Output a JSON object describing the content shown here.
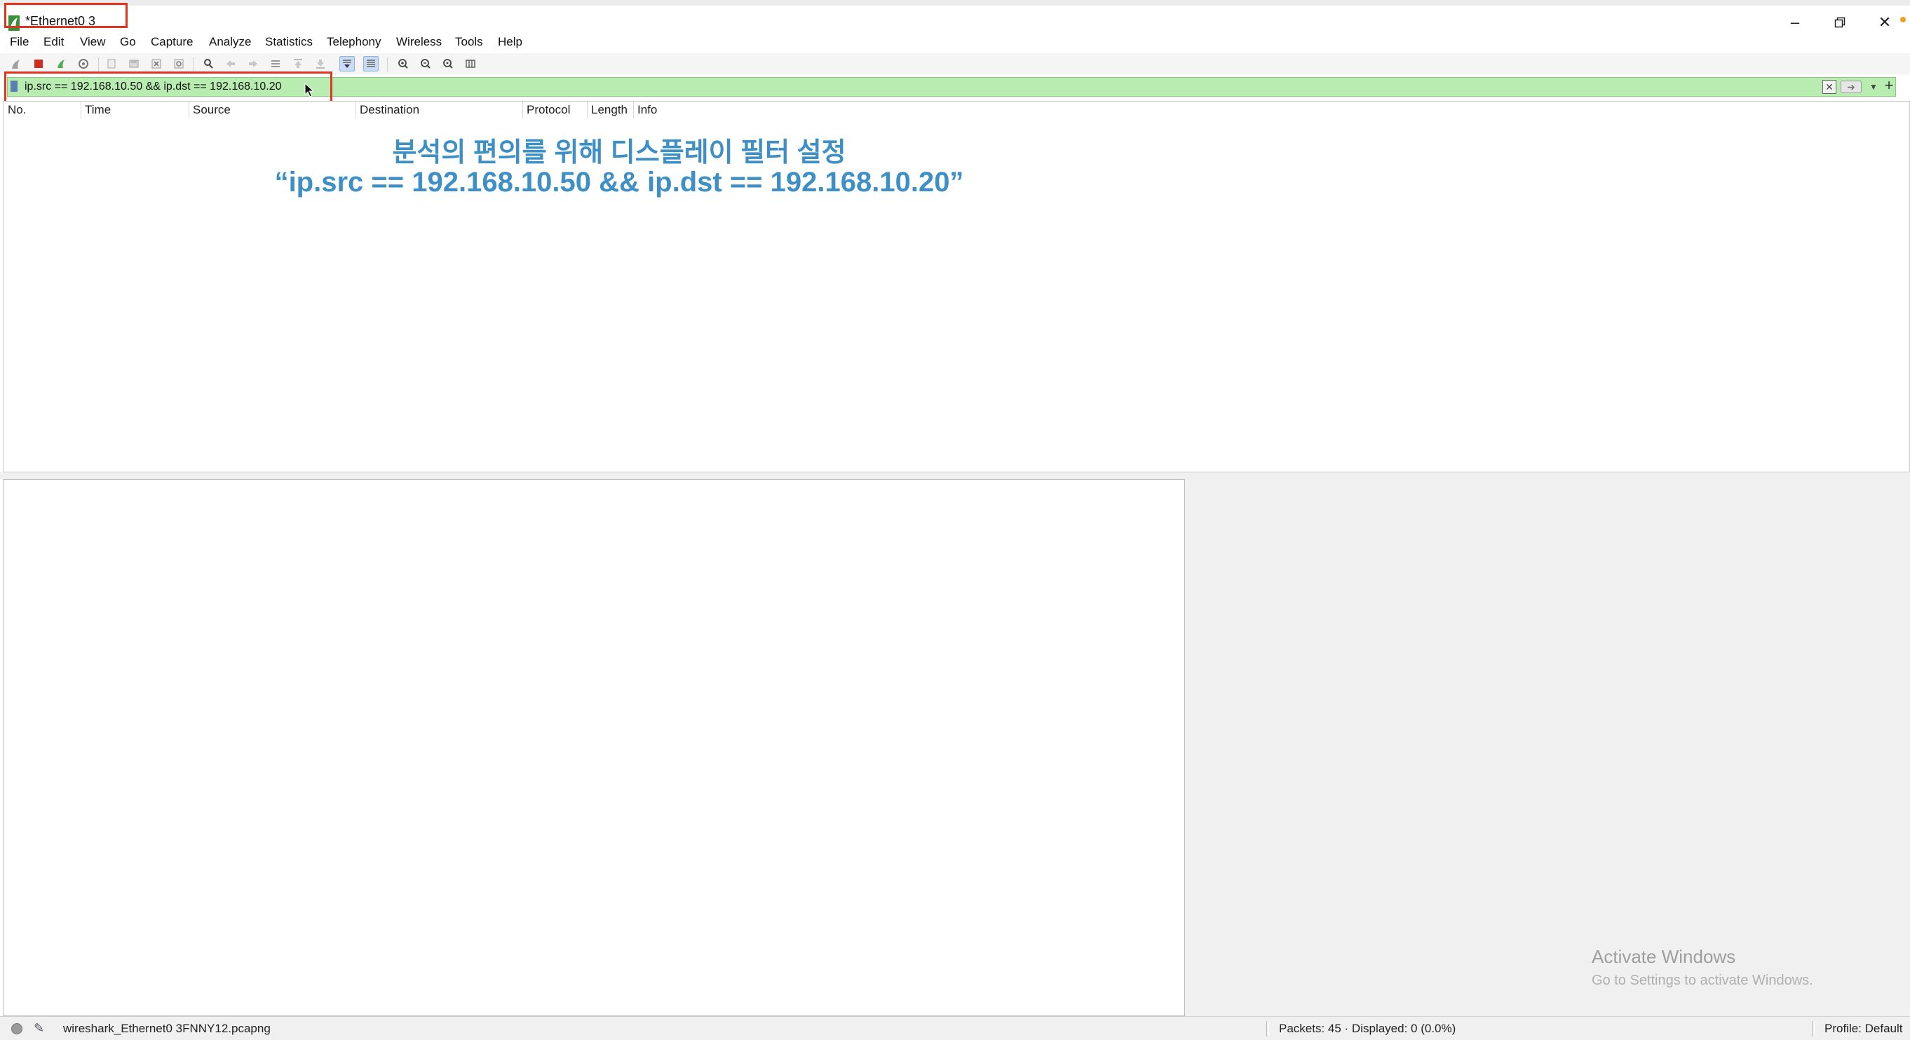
{
  "window": {
    "title": "*Ethernet0 3",
    "minimize_icon": "minimize-icon",
    "restore_icon": "restore-icon",
    "close_icon": "close-icon"
  },
  "menu": [
    "File",
    "Edit",
    "View",
    "Go",
    "Capture",
    "Analyze",
    "Statistics",
    "Telephony",
    "Wireless",
    "Tools",
    "Help"
  ],
  "toolbar": {
    "icons": [
      "shark-fin-start-icon",
      "stop-capture-icon",
      "restart-capture-icon",
      "capture-options-icon",
      "open-file-icon",
      "save-file-icon",
      "close-file-icon",
      "reload-file-icon",
      "find-packet-icon",
      "go-back-icon",
      "go-forward-icon",
      "go-to-packet-icon",
      "go-first-icon",
      "go-last-icon",
      "auto-scroll-icon",
      "colorize-icon",
      "zoom-in-icon",
      "zoom-out-icon",
      "zoom-reset-icon",
      "resize-columns-icon"
    ]
  },
  "filter": {
    "value": "ip.src == 192.168.10.50 && ip.dst == 192.168.10.20"
  },
  "columns": [
    "No.",
    "Time",
    "Source",
    "Destination",
    "Protocol",
    "Length",
    "Info"
  ],
  "annotation": {
    "line1": "분석의 편의를 위해 디스플레이 필터 설정",
    "line2": "“ip.src == 192.168.10.50 && ip.dst == 192.168.10.20”"
  },
  "watermark": {
    "line1": "Activate Windows",
    "line2": "Go to Settings to activate Windows."
  },
  "status": {
    "file": "wireshark_Ethernet0 3FNNY12.pcapng",
    "packets": "Packets: 45 · Displayed: 0 (0.0%)",
    "profile": "Profile: Default"
  },
  "colors": {
    "filter_valid_bg": "#b9ecb0",
    "highlight_box": "#e0341f",
    "annotation_text": "#3d8fc6"
  }
}
